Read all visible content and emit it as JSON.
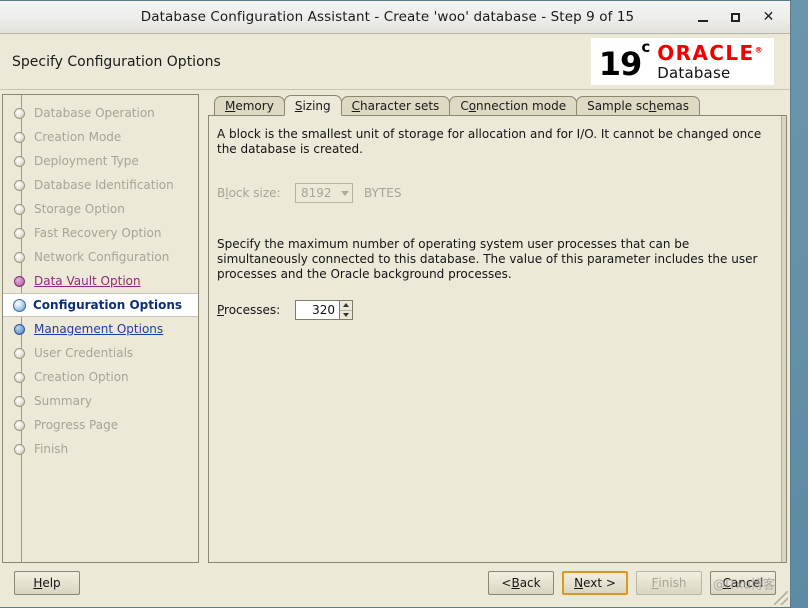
{
  "window": {
    "title": "Database Configuration Assistant - Create 'woo' database - Step 9 of 15",
    "controls": {
      "minimize": "minimize-icon",
      "maximize": "maximize-icon",
      "close": "close-icon"
    }
  },
  "header": {
    "page_title": "Specify Configuration Options",
    "logo": {
      "version": "19",
      "version_sup": "c",
      "brand": "ORACLE",
      "brand_sup": "®",
      "product": "Database",
      "brand_color": "#f00000"
    }
  },
  "sidebar": {
    "items": [
      {
        "label": "Database Operation",
        "state": "done"
      },
      {
        "label": "Creation Mode",
        "state": "done"
      },
      {
        "label": "Deployment Type",
        "state": "done"
      },
      {
        "label": "Database Identification",
        "state": "done"
      },
      {
        "label": "Storage Option",
        "state": "done"
      },
      {
        "label": "Fast Recovery Option",
        "state": "done"
      },
      {
        "label": "Network Configuration",
        "state": "done"
      },
      {
        "label": "Data Vault Option",
        "state": "visited"
      },
      {
        "label": "Configuration Options",
        "state": "current"
      },
      {
        "label": "Management Options",
        "state": "link"
      },
      {
        "label": "User Credentials",
        "state": "done"
      },
      {
        "label": "Creation Option",
        "state": "done"
      },
      {
        "label": "Summary",
        "state": "done"
      },
      {
        "label": "Progress Page",
        "state": "done"
      },
      {
        "label": "Finish",
        "state": "done"
      }
    ]
  },
  "tabs": [
    {
      "pre": "",
      "mn": "M",
      "post": "emory",
      "active": false
    },
    {
      "pre": "",
      "mn": "S",
      "post": "izing",
      "active": true
    },
    {
      "pre": "",
      "mn": "C",
      "post": "haracter sets",
      "active": false
    },
    {
      "pre": "C",
      "mn": "o",
      "post": "nnection mode",
      "active": false
    },
    {
      "pre": "Sample sc",
      "mn": "h",
      "post": "emas",
      "active": false
    }
  ],
  "panel": {
    "block_paragraph": "A block is the smallest unit of storage for allocation and for I/O. It cannot be changed once the database is created.",
    "block_size": {
      "label_pre": "B",
      "label_mn": "l",
      "label_post": "ock size:",
      "value": "8192",
      "unit": "BYTES",
      "enabled": false
    },
    "processes_paragraph": "Specify the maximum number of operating system user processes that can be simultaneously connected to this database. The value of this parameter includes the user processes and the Oracle background processes.",
    "processes": {
      "label_pre": "",
      "label_mn": "P",
      "label_post": "rocesses:",
      "value": "320"
    }
  },
  "footer": {
    "help": {
      "pre": "",
      "mn": "H",
      "post": "elp",
      "enabled": true,
      "focused": false
    },
    "back": {
      "pre": "< ",
      "mn": "B",
      "post": "ack",
      "enabled": true,
      "focused": false
    },
    "next": {
      "pre": "",
      "mn": "N",
      "post": "ext >",
      "enabled": true,
      "focused": true
    },
    "finish": {
      "pre": "",
      "mn": "F",
      "post": "inish",
      "enabled": false,
      "focused": false
    },
    "cancel": {
      "pre": "",
      "mn": "C",
      "post": "ancel",
      "enabled": true,
      "focused": false
    }
  },
  "watermark": {
    "text": "@ITxu博客"
  }
}
